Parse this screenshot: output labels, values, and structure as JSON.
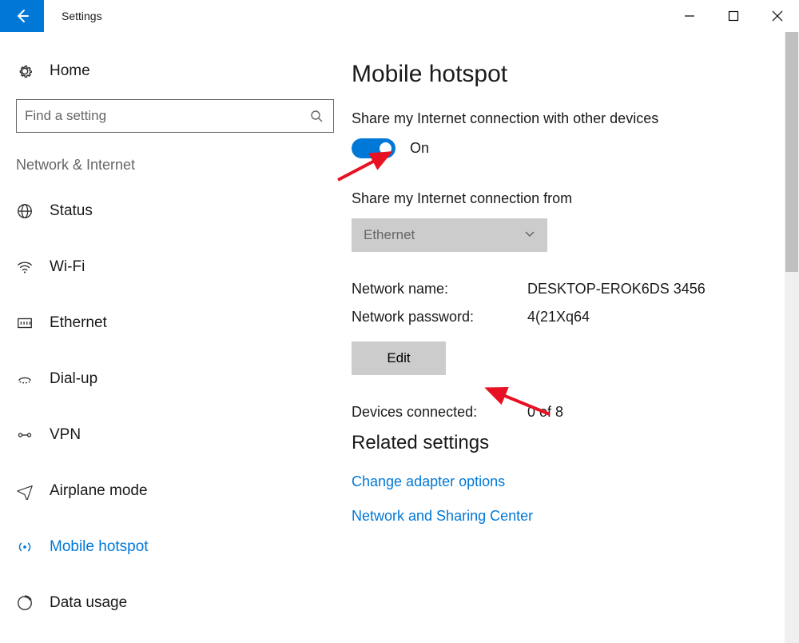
{
  "window": {
    "title": "Settings"
  },
  "sidebar": {
    "home": "Home",
    "search_placeholder": "Find a setting",
    "category": "Network & Internet",
    "items": [
      {
        "label": "Status"
      },
      {
        "label": "Wi-Fi"
      },
      {
        "label": "Ethernet"
      },
      {
        "label": "Dial-up"
      },
      {
        "label": "VPN"
      },
      {
        "label": "Airplane mode"
      },
      {
        "label": "Mobile hotspot"
      },
      {
        "label": "Data usage"
      }
    ]
  },
  "main": {
    "title": "Mobile hotspot",
    "share_label": "Share my Internet connection with other devices",
    "toggle_state": "On",
    "from_label": "Share my Internet connection from",
    "from_value": "Ethernet",
    "network_name_label": "Network name:",
    "network_name_value": "DESKTOP-EROK6DS 3456",
    "network_password_label": "Network password:",
    "network_password_value": "4(21Xq64",
    "edit_label": "Edit",
    "devices_label": "Devices connected:",
    "devices_value": "0 of 8",
    "related_heading": "Related settings",
    "links": [
      "Change adapter options",
      "Network and Sharing Center"
    ]
  }
}
